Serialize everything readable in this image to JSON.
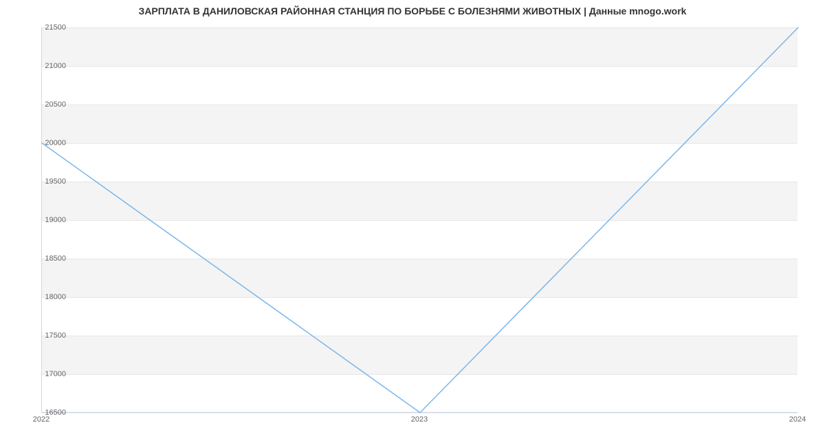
{
  "chart_data": {
    "type": "line",
    "title": "ЗАРПЛАТА В ДАНИЛОВСКАЯ РАЙОННАЯ СТАНЦИЯ ПО БОРЬБЕ С БОЛЕЗНЯМИ ЖИВОТНЫХ | Данные mnogo.work",
    "xlabel": "",
    "ylabel": "",
    "x": [
      "2022",
      "2023",
      "2024"
    ],
    "values": [
      20000,
      16500,
      21500
    ],
    "ylim": [
      16500,
      21500
    ],
    "y_ticks": [
      16500,
      17000,
      17500,
      18000,
      18500,
      19000,
      19500,
      20000,
      20500,
      21000,
      21500
    ],
    "x_ticks": [
      "2022",
      "2023",
      "2024"
    ],
    "grid": true,
    "line_color": "#7cb5ec"
  }
}
